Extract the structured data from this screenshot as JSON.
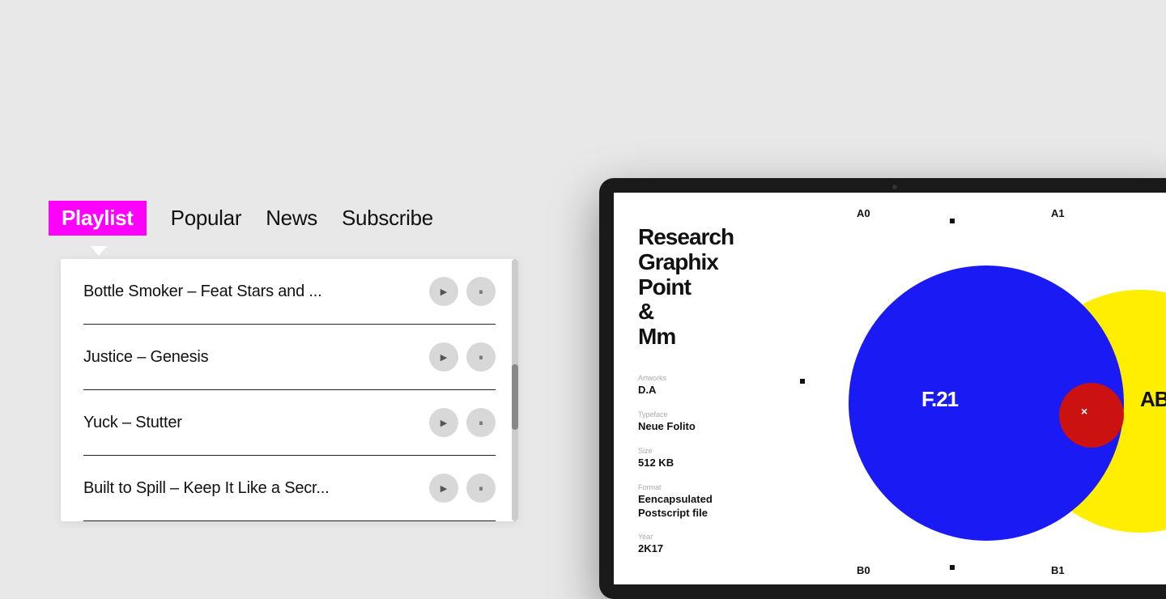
{
  "nav": {
    "tabs": [
      {
        "id": "playlist",
        "label": "Playlist",
        "active": true
      },
      {
        "id": "popular",
        "label": "Popular",
        "active": false
      },
      {
        "id": "news",
        "label": "News",
        "active": false
      },
      {
        "id": "subscribe",
        "label": "Subscribe",
        "active": false
      }
    ]
  },
  "playlist": {
    "tracks": [
      {
        "title": "Bottle Smoker –  Feat Stars and ...",
        "id": "track-1"
      },
      {
        "title": "Justice – Genesis",
        "id": "track-2"
      },
      {
        "title": "Yuck – Stutter",
        "id": "track-3"
      },
      {
        "title": "Built to Spill – Keep It Like a Secr...",
        "id": "track-4"
      }
    ]
  },
  "tablet": {
    "brand": "Research\nGraphix\nPoint\n&\nMm",
    "fields": {
      "artworks_label": "Artworks",
      "artworks_value": "D.A",
      "typeface_label": "Typeface",
      "typeface_value": "Neue Folito",
      "size_label": "Size",
      "size_value": "512 KB",
      "format_label": "Format",
      "format_value": "Eencapsulated\nPostscript file",
      "year_label": "Year",
      "year_value": "2K17"
    },
    "grid": {
      "a0": "A0",
      "a1": "A1",
      "b0": "B0",
      "b1": "B1",
      "f21": "F.21",
      "ab": "AB",
      "x": "×"
    }
  }
}
